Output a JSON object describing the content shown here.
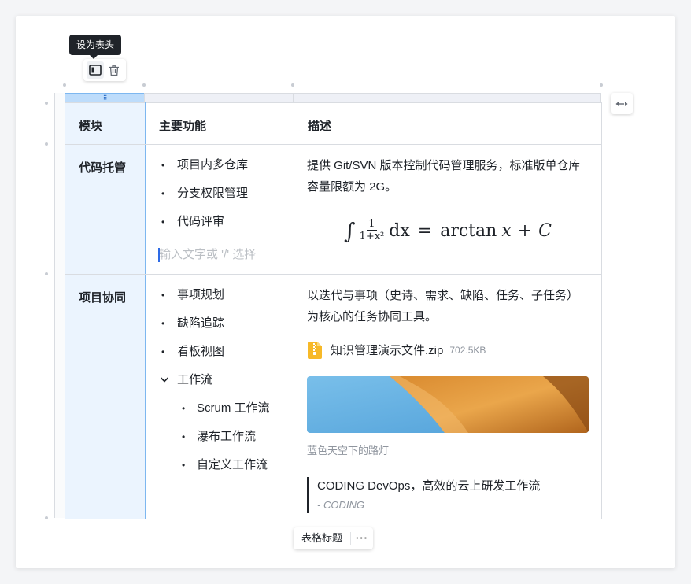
{
  "tooltip": {
    "text": "设为表头"
  },
  "mini_toolbar": {
    "icons": [
      "table-header-icon",
      "trash-icon"
    ]
  },
  "table": {
    "headers": [
      "模块",
      "主要功能",
      "描述"
    ],
    "rows": [
      {
        "module": "代码托管",
        "features": [
          "项目内多仓库",
          "分支权限管理",
          "代码评审"
        ],
        "input_placeholder": "输入文字或 '/' 选择",
        "description": "提供 Git/SVN 版本控制代码管理服务，标准版单仓库容量限额为 2G。",
        "formula": {
          "int": "∫",
          "num": "1",
          "den": "1+x²",
          "dx": "dx",
          "eq": "=",
          "fn": "arctan",
          "var": "x",
          "plus": "+",
          "const": "C"
        }
      },
      {
        "module": "项目协同",
        "features": [
          "事项规划",
          "缺陷追踪",
          "看板视图"
        ],
        "workflow": {
          "label": "工作流",
          "children": [
            "Scrum 工作流",
            "瀑布工作流",
            "自定义工作流"
          ]
        },
        "description": "以迭代与事项（史诗、需求、缺陷、任务、子任务）为核心的任务协同工具。",
        "file": {
          "name": "知识管理演示文件.zip",
          "size": "702.5KB",
          "icon": "zip-file-icon"
        },
        "image": {
          "caption": "蓝色天空下的路灯"
        },
        "quote": {
          "text": "CODING DevOps，高效的云上研发工作流",
          "author": "- CODING"
        }
      }
    ]
  },
  "table_caption_button": "表格标题",
  "more_button": "···",
  "colors": {
    "selected": "#ebf4fe",
    "selected_border": "#7db7f0",
    "caret": "#2e6be6",
    "zip": "#f7b928"
  }
}
